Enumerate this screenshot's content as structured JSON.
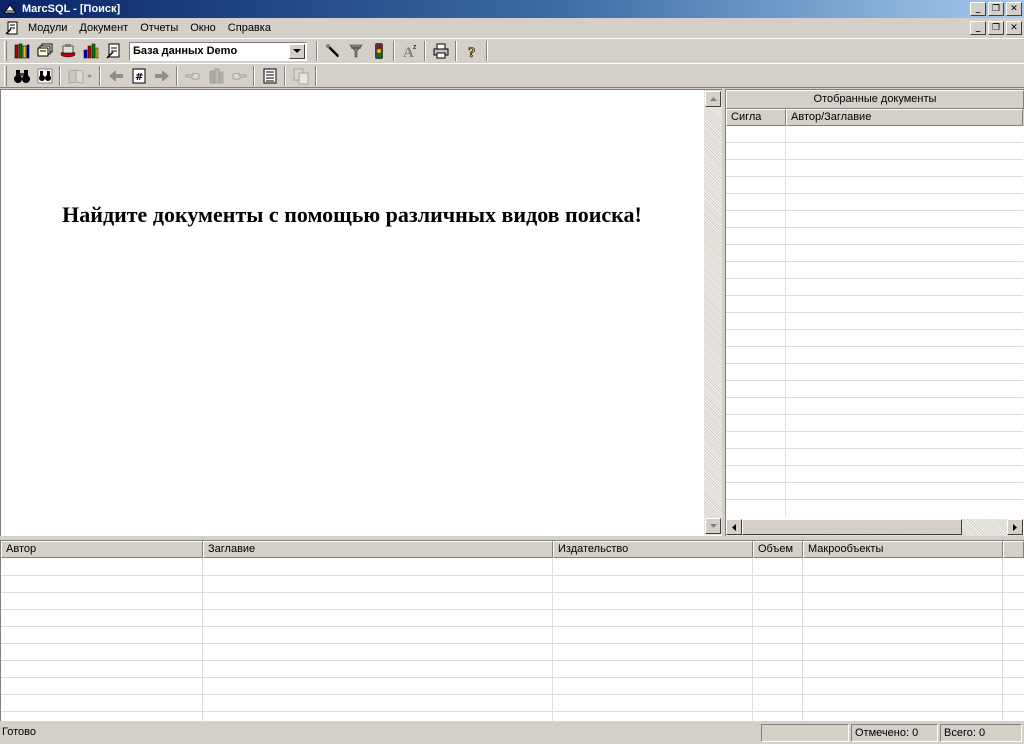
{
  "window": {
    "title": "MarcSQL - [Поиск]"
  },
  "menu": {
    "items": [
      "Модули",
      "Документ",
      "Отчеты",
      "Окно",
      "Справка"
    ]
  },
  "toolbar1": {
    "icons": [
      "books-icon",
      "cards-icon",
      "stamp-icon",
      "bars-icon",
      "reader-icon"
    ],
    "database_select": "База данных Demo",
    "right_icons": [
      "pen-icon",
      "filter-icon",
      "traffic-light-icon",
      "font-icon",
      "printer-icon",
      "help-icon"
    ]
  },
  "toolbar2": {
    "icons": [
      "binoculars-icon",
      "binoculars-search-icon",
      "book-icon",
      "arrow-left-icon",
      "hash-icon",
      "arrow-right-icon",
      "hand-left-icon",
      "books-stack-icon",
      "hand-right-icon",
      "list-icon",
      "copy-icon"
    ]
  },
  "main": {
    "welcome_text": "Найдите документы с помощью различных видов поиска!"
  },
  "selected_docs": {
    "header": "Отобранные документы",
    "columns": [
      "Сигла",
      "Автор/Заглавие"
    ],
    "rows": []
  },
  "results_table": {
    "columns": [
      "Автор",
      "Заглавие",
      "Издательство",
      "Объем",
      "Макрообъекты"
    ],
    "rows": []
  },
  "status": {
    "main": "Готово",
    "empty_cell": "",
    "marked": "Отмечено: 0",
    "total": "Всего: 0"
  }
}
